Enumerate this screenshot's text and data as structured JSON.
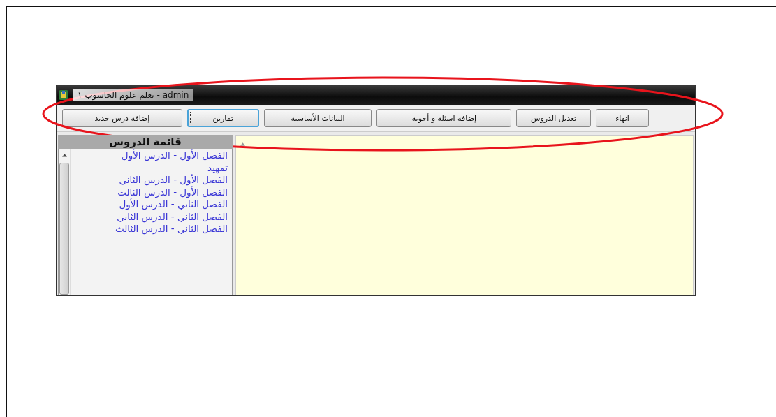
{
  "window": {
    "title": "تعلم علوم الحاسوب ١ - admin"
  },
  "toolbar": {
    "buttons": [
      {
        "label": "انهاء",
        "focused": false
      },
      {
        "label": "تعديل الدروس",
        "focused": false
      },
      {
        "label": "إضافة اسئلة و أجوبة",
        "focused": false
      },
      {
        "label": "البيانات الأساسية",
        "focused": false
      },
      {
        "label": "تمارين",
        "focused": true
      },
      {
        "label": "إضافة درس جديد",
        "focused": false
      }
    ]
  },
  "lessons": {
    "title": "قائمة الدروس",
    "items": [
      "الفصل الأول - الدرس الأول",
      "تمهيد",
      "الفصل الأول - الدرس الثاني",
      "الفصل الأول - الدرس الثالث",
      "الفصل الثاني - الدرس الأول",
      "الفصل الثاني - الدرس الثاني",
      "الفصل الثاني - الدرس الثالث"
    ]
  }
}
